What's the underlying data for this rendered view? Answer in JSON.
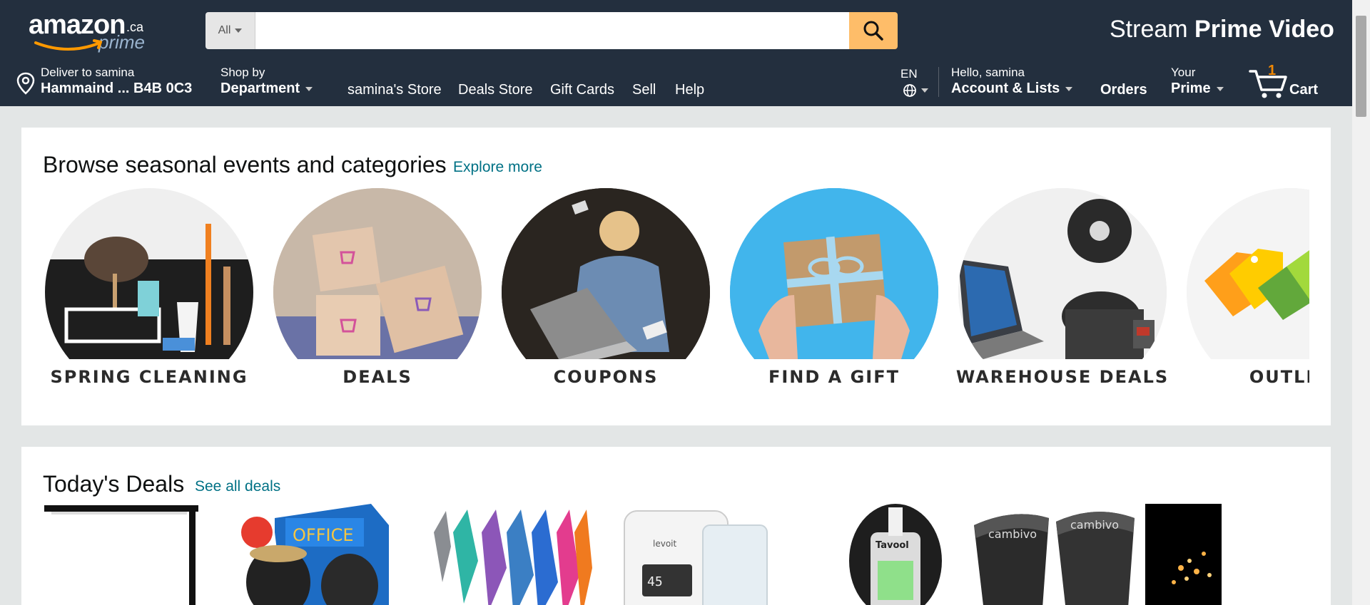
{
  "header": {
    "logo_text": "amazon",
    "logo_tld": ".ca",
    "logo_sub": "prime",
    "search": {
      "category": "All",
      "placeholder": "",
      "value": ""
    },
    "promo_light": "Stream ",
    "promo_bold": "Prime Video"
  },
  "nav": {
    "deliver_line1": "Deliver to samina",
    "deliver_line2": "Hammaind ... B4B 0C3",
    "shop_line1": "Shop by",
    "shop_line2": "Department",
    "links": [
      "samina's Store",
      "Deals Store",
      "Gift Cards",
      "Sell",
      "Help"
    ],
    "language": "EN",
    "account_line1": "Hello, samina",
    "account_line2": "Account & Lists",
    "orders": "Orders",
    "prime_line1": "Your",
    "prime_line2": "Prime",
    "cart_count": "1",
    "cart_label": "Cart"
  },
  "browse": {
    "title": "Browse seasonal events and categories",
    "more": "Explore more",
    "categories": [
      "SPRING CLEANING",
      "DEALS",
      "COUPONS",
      "FIND A GIFT",
      "WAREHOUSE DEALS",
      "OUTLET"
    ]
  },
  "deals": {
    "title": "Today's Deals",
    "more": "See all deals",
    "items": [
      "desk-lamp",
      "officepro-product",
      "microfiber-towels",
      "levoit-humidifier",
      "tavool-meter",
      "cambivo-knee-sleeves",
      "string-lights"
    ]
  },
  "colors": {
    "header_bg": "#232f3e",
    "search_button": "#febd69",
    "link": "#007185",
    "cart_count": "#f08804",
    "page_bg": "#e3e6e6"
  },
  "icons": [
    "location-pin-icon",
    "search-icon",
    "globe-icon",
    "cart-icon",
    "smile-arrow-icon"
  ]
}
